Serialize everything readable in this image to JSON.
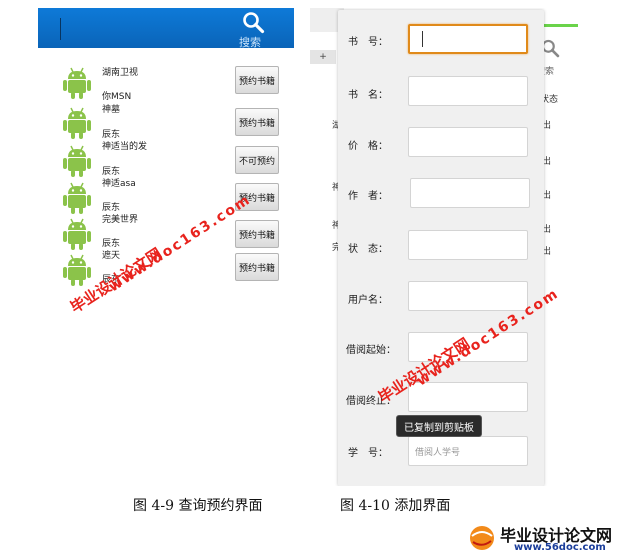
{
  "left_screen": {
    "search_label": "搜索",
    "items": [
      {
        "line_top": "湖南卫视",
        "line_bottom": "你MSN",
        "button": "预约书籍"
      },
      {
        "line_top": "神墓",
        "line_bottom": "辰东",
        "button": "预约书籍"
      },
      {
        "line_top": "神适当的发",
        "line_bottom": "辰东",
        "button": "不可预约"
      },
      {
        "line_top": "神适asa",
        "line_bottom": "辰东",
        "button": "预约书籍"
      },
      {
        "line_top": "完美世界",
        "line_bottom": "辰东",
        "button": "预约书籍"
      },
      {
        "line_top": "遮天",
        "line_bottom": "辰东",
        "button": "预约书籍"
      }
    ]
  },
  "right_screen": {
    "plus_tab": "+",
    "behind": {
      "search_label": "搜索",
      "status_header": "状态",
      "fragments": [
        "湖",
        "出",
        "出",
        "神",
        "出",
        "神",
        "完",
        "出",
        "出"
      ]
    },
    "fields": [
      {
        "label": "书　号：",
        "value": "",
        "placeholder": ""
      },
      {
        "label": "书　名：",
        "value": "",
        "placeholder": ""
      },
      {
        "label": "价　格：",
        "value": "",
        "placeholder": ""
      },
      {
        "label": "作　者：",
        "value": "",
        "placeholder": ""
      },
      {
        "label": "状　态：",
        "value": "",
        "placeholder": ""
      },
      {
        "label": "用户名：",
        "value": "",
        "placeholder": ""
      },
      {
        "label": "借阅起始：",
        "value": "",
        "placeholder": ""
      },
      {
        "label": "借阅终止：",
        "value": "",
        "placeholder": ""
      },
      {
        "label": "学　号：",
        "value": "",
        "placeholder": "借阅人学号"
      }
    ],
    "toast": "已复制到剪贴板"
  },
  "captions": {
    "left": "图 4-9 查询预约界面",
    "right": "图 4-10 添加界面"
  },
  "watermark": {
    "cn": "毕业设计论文网",
    "url": "www.doc163.com",
    "logo_cn": "毕业设计论文网",
    "logo_url": "www.56doc.com"
  },
  "colors": {
    "header_blue": "#0a6dc6",
    "focus_orange": "#e08a1a",
    "watermark_red": "#e8231d",
    "android_green": "#8bc34a"
  }
}
